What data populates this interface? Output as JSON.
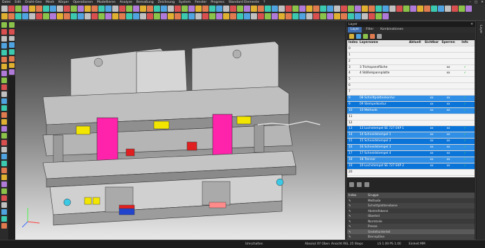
{
  "menu": [
    "Datei",
    "Edit",
    "Draht-Geo",
    "Mesh",
    "Körper",
    "Operationen",
    "Modellieren",
    "Analyse",
    "Bemaßung",
    "Zeichnung",
    "System",
    "Fenster",
    "Progress",
    "Standard Elemente",
    "?"
  ],
  "panel": {
    "title": "Layer",
    "tabs": [
      "Layer",
      "Filter",
      "Kombinationen"
    ],
    "columns": [
      "Index",
      "Layername",
      "Aktuell",
      "Sichtbar",
      "Sperren",
      "Info"
    ],
    "rows": [
      {
        "index": "0",
        "name": "",
        "vis": "",
        "lock": "",
        "info": ""
      },
      {
        "index": "1",
        "name": "",
        "vis": "",
        "lock": "",
        "info": ""
      },
      {
        "index": "2",
        "name": "",
        "vis": "",
        "lock": "",
        "info": ""
      },
      {
        "index": "3",
        "name": "3 Trichspannfläche",
        "vis": "",
        "lock": "xx",
        "info": "✓"
      },
      {
        "index": "4",
        "name": "4 Stößelspannplatte",
        "vis": "",
        "lock": "xx",
        "info": "✓"
      },
      {
        "index": "5",
        "name": "",
        "vis": "",
        "lock": "",
        "info": ""
      },
      {
        "index": "6",
        "name": "",
        "vis": "",
        "lock": "",
        "info": ""
      },
      {
        "index": "7",
        "name": "",
        "vis": "",
        "lock": "",
        "info": ""
      },
      {
        "index": "8",
        "name": "08 Schnittplattenkontur",
        "vis": "xx",
        "lock": "xx",
        "info": "✓"
      },
      {
        "index": "9",
        "name": "09 Stempelkontur",
        "vis": "xx",
        "lock": "xx",
        "info": "✓"
      },
      {
        "index": "10",
        "name": "10 Methode",
        "vis": "xx",
        "lock": "xx",
        "info": "✓"
      },
      {
        "index": "11",
        "name": "",
        "vis": "",
        "lock": "",
        "info": ""
      },
      {
        "index": "12",
        "name": "",
        "vis": "",
        "lock": "",
        "info": ""
      },
      {
        "index": "13",
        "name": "13 Lochstempel SE 727 EKP 1",
        "vis": "xx",
        "lock": "xx",
        "info": "✓"
      },
      {
        "index": "14",
        "name": "14 Schneidstempel 1",
        "vis": "xx",
        "lock": "xx",
        "info": "✓"
      },
      {
        "index": "15",
        "name": "15 Schneidstempel 2",
        "vis": "xx",
        "lock": "xx",
        "info": "✓"
      },
      {
        "index": "16",
        "name": "16 Schneidstempel 3",
        "vis": "xx",
        "lock": "xx",
        "info": "✓"
      },
      {
        "index": "17",
        "name": "17 Schneidstempel 4",
        "vis": "xx",
        "lock": "xx",
        "info": "✓"
      },
      {
        "index": "18",
        "name": "18 Trenner",
        "vis": "xx",
        "lock": "xx",
        "info": "✓"
      },
      {
        "index": "19",
        "name": "19 Lochstempel SE 727 EKP 2",
        "vis": "xx",
        "lock": "xx",
        "info": "✓"
      },
      {
        "index": "20",
        "name": "",
        "vis": "",
        "lock": "",
        "info": ""
      }
    ],
    "group_columns": [
      "Index",
      "Gruppe"
    ],
    "groups": [
      "Methode",
      "Schnittplattenebene",
      "Abstreifebene",
      "Oberteil",
      "Normteile",
      "Presse",
      "Gestellunterteil",
      "Brennpläne"
    ],
    "side_label": "Layer"
  },
  "status": {
    "mode": "Umschalten",
    "view": "Ansicht REL",
    "plane": "Absolut XY Oben",
    "steps": "25 Steps",
    "scale": "LS 1.00 PS 1.00",
    "unit": "Einheit MM"
  },
  "colors": {
    "accent": "#0a74d9",
    "highlight": "#ff00aa",
    "yellow": "#f2e600"
  }
}
